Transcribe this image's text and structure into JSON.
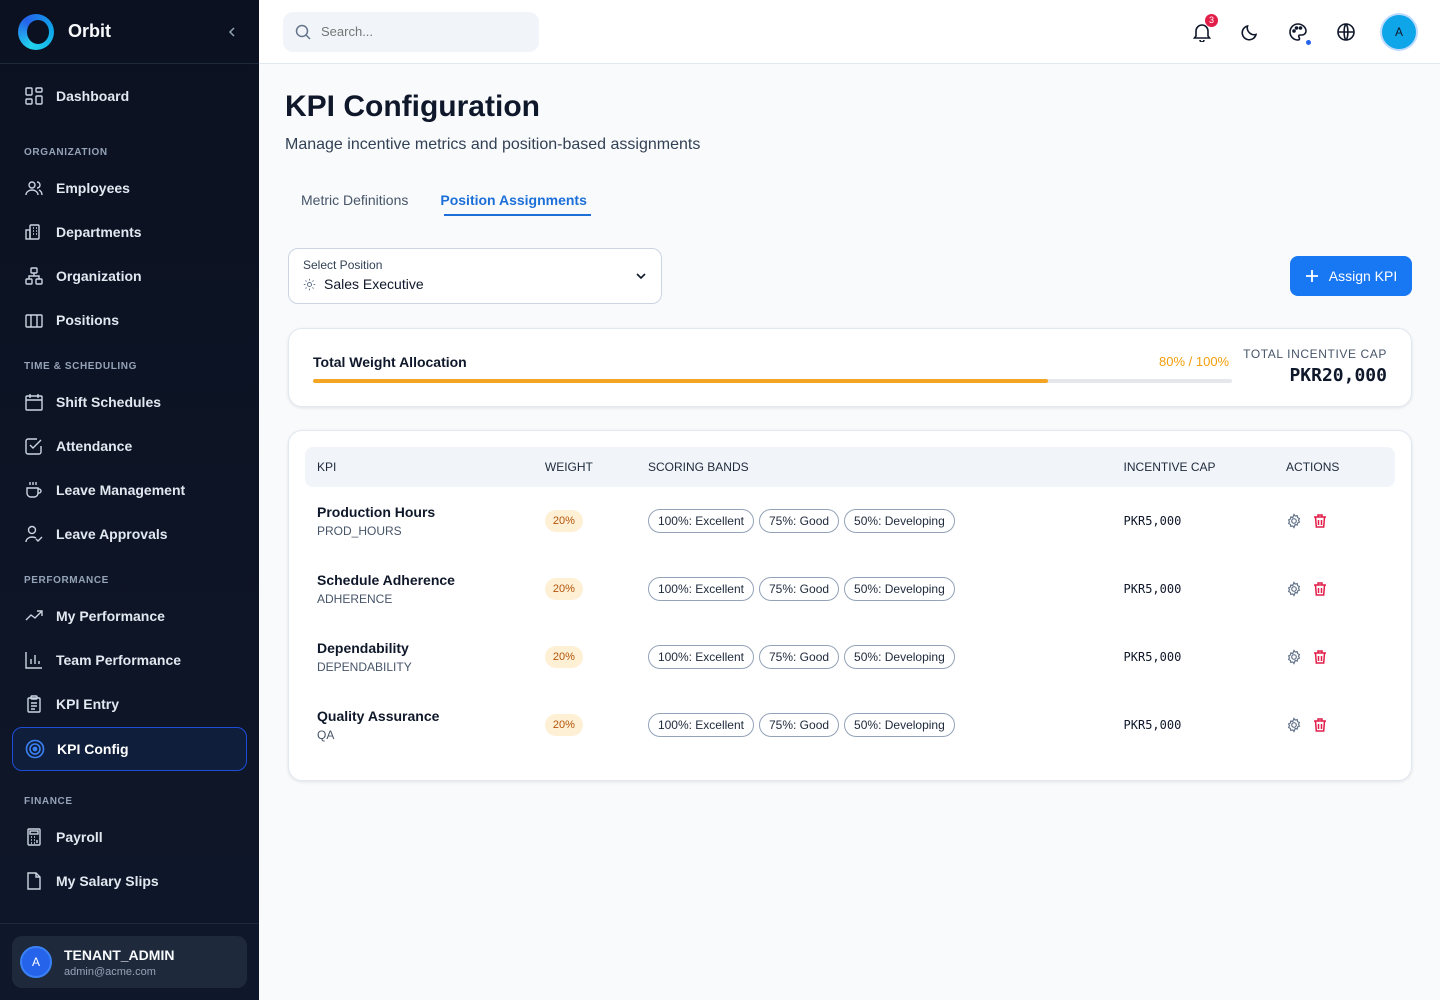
{
  "app": {
    "name": "Orbit"
  },
  "sidebar": {
    "dashboard": "Dashboard",
    "sections": {
      "organization": "ORGANIZATION",
      "time": "TIME & SCHEDULING",
      "performance": "PERFORMANCE",
      "finance": "FINANCE"
    },
    "items": {
      "employees": "Employees",
      "departments": "Departments",
      "organization": "Organization",
      "positions": "Positions",
      "shift_schedules": "Shift Schedules",
      "attendance": "Attendance",
      "leave_management": "Leave Management",
      "leave_approvals": "Leave Approvals",
      "my_performance": "My Performance",
      "team_performance": "Team Performance",
      "kpi_entry": "KPI Entry",
      "kpi_config": "KPI Config",
      "payroll": "Payroll",
      "my_salary_slips": "My Salary Slips"
    },
    "user": {
      "initial": "A",
      "role": "TENANT_ADMIN",
      "email": "admin@acme.com"
    }
  },
  "topbar": {
    "search_placeholder": "Search...",
    "notification_count": "3",
    "avatar_initial": "A"
  },
  "page": {
    "title": "KPI Configuration",
    "subtitle": "Manage incentive metrics and position-based assignments",
    "tabs": [
      "Metric Definitions",
      "Position Assignments"
    ],
    "active_tab": "Position Assignments"
  },
  "position_select": {
    "label": "Select Position",
    "value": "Sales Executive"
  },
  "assign_button": "Assign KPI",
  "allocation": {
    "title": "Total Weight Allocation",
    "pct_text": "80% / 100%",
    "progress": 0.8,
    "cap_label": "TOTAL INCENTIVE CAP",
    "cap_value": "PKR20,000"
  },
  "table": {
    "headers": {
      "kpi": "KPI",
      "weight": "WEIGHT",
      "bands": "SCORING BANDS",
      "cap": "INCENTIVE CAP",
      "actions": "ACTIONS"
    },
    "rows": [
      {
        "name": "Production Hours",
        "code": "PROD_HOURS",
        "weight": "20%",
        "bands": [
          "100%: Excellent",
          "75%: Good",
          "50%: Developing"
        ],
        "cap": "PKR5,000"
      },
      {
        "name": "Schedule Adherence",
        "code": "ADHERENCE",
        "weight": "20%",
        "bands": [
          "100%: Excellent",
          "75%: Good",
          "50%: Developing"
        ],
        "cap": "PKR5,000"
      },
      {
        "name": "Dependability",
        "code": "DEPENDABILITY",
        "weight": "20%",
        "bands": [
          "100%: Excellent",
          "75%: Good",
          "50%: Developing"
        ],
        "cap": "PKR5,000"
      },
      {
        "name": "Quality Assurance",
        "code": "QA",
        "weight": "20%",
        "bands": [
          "100%: Excellent",
          "75%: Good",
          "50%: Developing"
        ],
        "cap": "PKR5,000"
      }
    ]
  },
  "colors": {
    "accent": "#1877f2",
    "warning": "#f5a524",
    "danger": "#e11d48",
    "sidebar_bg": "#0f172a"
  }
}
